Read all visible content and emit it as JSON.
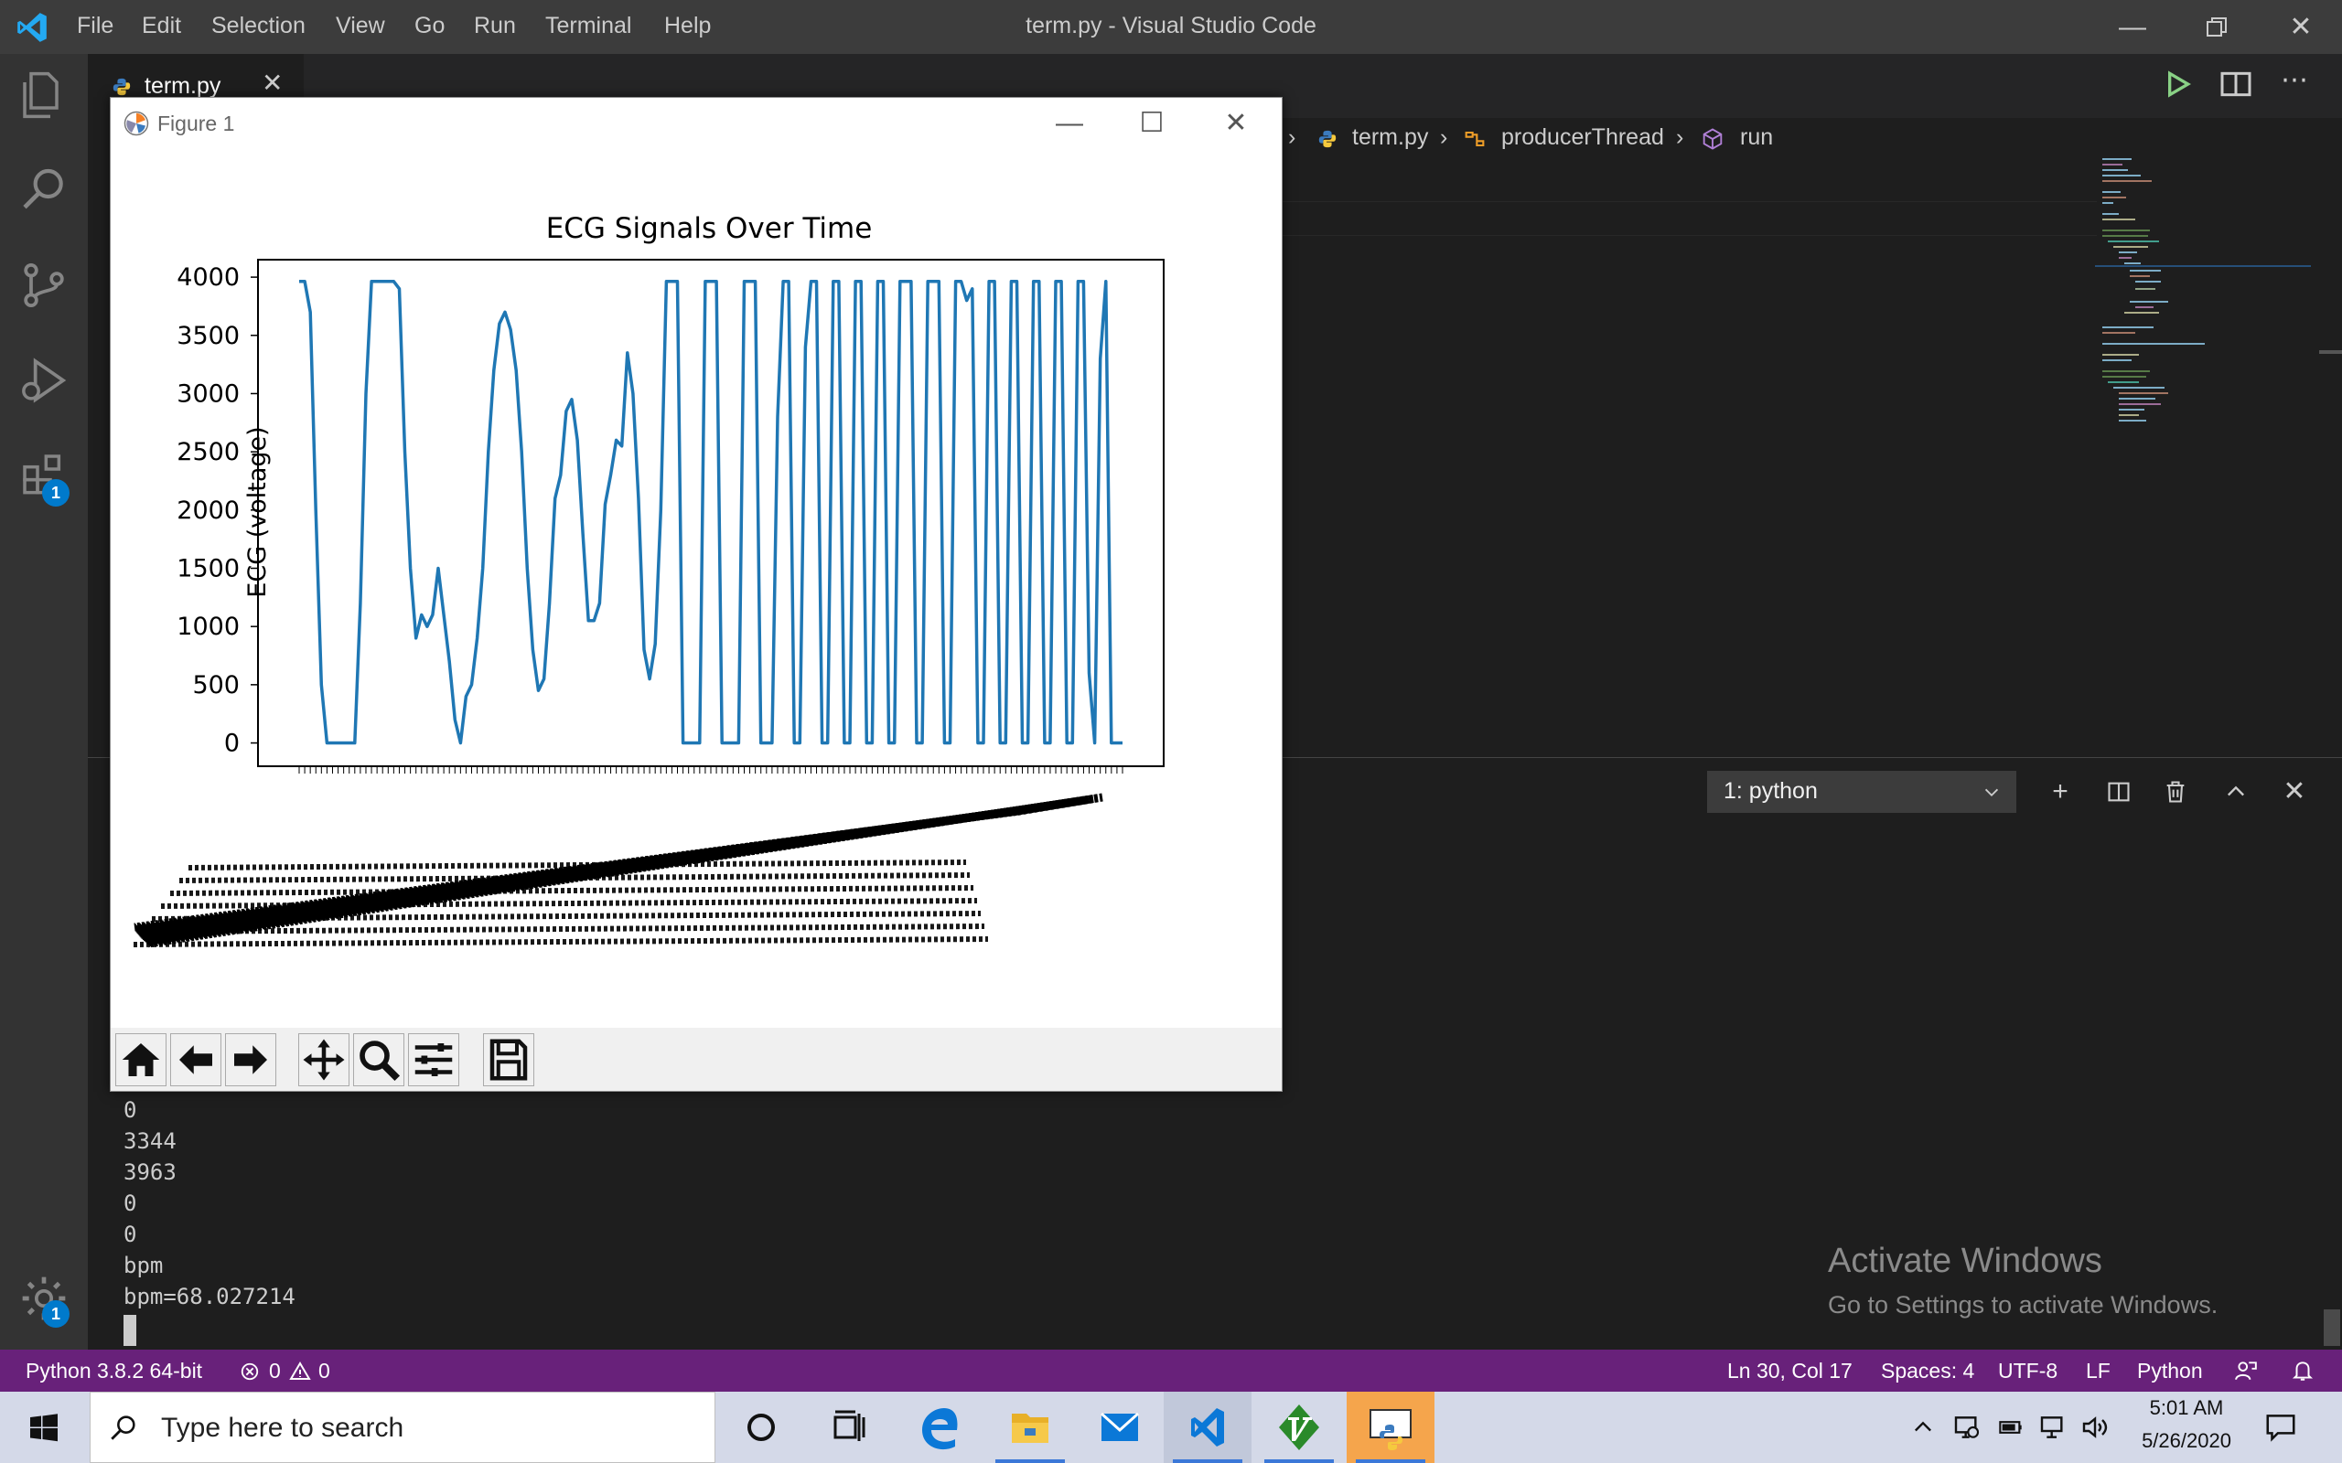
{
  "window": {
    "title": "term.py - Visual Studio Code",
    "menu": [
      "File",
      "Edit",
      "Selection",
      "View",
      "Go",
      "Run",
      "Terminal",
      "Help"
    ],
    "controls": [
      "minimize-icon",
      "restore-icon",
      "close-icon"
    ]
  },
  "activity_bar": {
    "items": [
      "explorer-icon",
      "search-icon",
      "source-control-icon",
      "run-debug-icon",
      "extensions-icon"
    ],
    "extensions_badge": "1",
    "manage_badge": "1"
  },
  "editor": {
    "tab": {
      "label": "term.py",
      "close": "✕"
    },
    "breadcrumb": {
      "file": "term.py",
      "class": "producerThread",
      "method": "run",
      "sep": "›"
    }
  },
  "panel": {
    "terminal_select": "1: python",
    "lines": [
      "0",
      "3344",
      "3963",
      "0",
      "0",
      "bpm",
      "bpm=68.027214"
    ],
    "watermark_title": "Activate Windows",
    "watermark_sub": "Go to Settings to activate Windows."
  },
  "status_bar": {
    "interpreter": "Python 3.8.2 64-bit",
    "errors": "0",
    "warnings": "0",
    "position": "Ln 30, Col 17",
    "spaces": "Spaces: 4",
    "encoding": "UTF-8",
    "eol": "LF",
    "language": "Python"
  },
  "taskbar": {
    "search_placeholder": "Type here to search",
    "time": "5:01 AM",
    "date": "5/26/2020"
  },
  "figure": {
    "title": "Figure 1",
    "toolbar": [
      "home-icon",
      "back-icon",
      "forward-icon",
      "pan-icon",
      "zoom-icon",
      "configure-icon",
      "save-icon"
    ]
  },
  "chart_data": {
    "type": "line",
    "title": "ECG Signals Over Time",
    "xlabel": "",
    "ylabel": "ECG (voltage)",
    "ylim": [
      -200,
      4150
    ],
    "yticks": [
      0,
      500,
      1000,
      1500,
      2000,
      2500,
      3000,
      3500,
      4000
    ],
    "series_color": "#1f77b4",
    "values": [
      3963,
      3963,
      3700,
      2000,
      500,
      0,
      0,
      0,
      0,
      0,
      0,
      1200,
      3000,
      3963,
      3963,
      3963,
      3963,
      3963,
      3900,
      2500,
      1500,
      900,
      1100,
      1000,
      1100,
      1500,
      1100,
      700,
      200,
      0,
      400,
      500,
      900,
      1500,
      2500,
      3200,
      3600,
      3700,
      3550,
      3200,
      2500,
      1500,
      800,
      450,
      550,
      1200,
      2100,
      2300,
      2850,
      2950,
      2600,
      1800,
      1050,
      1050,
      1200,
      2050,
      2300,
      2600,
      2550,
      3350,
      3000,
      2100,
      800,
      550,
      850,
      2000,
      3963,
      3963,
      3963,
      0,
      0,
      0,
      0,
      3963,
      3963,
      3963,
      0,
      0,
      0,
      0,
      3963,
      3963,
      3963,
      0,
      0,
      0,
      2800,
      3963,
      3963,
      0,
      0,
      3400,
      3963,
      3963,
      0,
      0,
      3963,
      3963,
      0,
      0,
      3963,
      3963,
      0,
      0,
      3963,
      3963,
      0,
      0,
      3963,
      3963,
      3963,
      0,
      0,
      3963,
      3963,
      3963,
      0,
      0,
      3963,
      3963,
      3800,
      3900,
      0,
      0,
      3963,
      3963,
      0,
      0,
      3963,
      3963,
      0,
      0,
      3963,
      3963,
      0,
      0,
      3963,
      3963,
      0,
      0,
      3963,
      3963,
      600,
      0,
      3300,
      3963,
      0,
      0,
      0
    ]
  }
}
